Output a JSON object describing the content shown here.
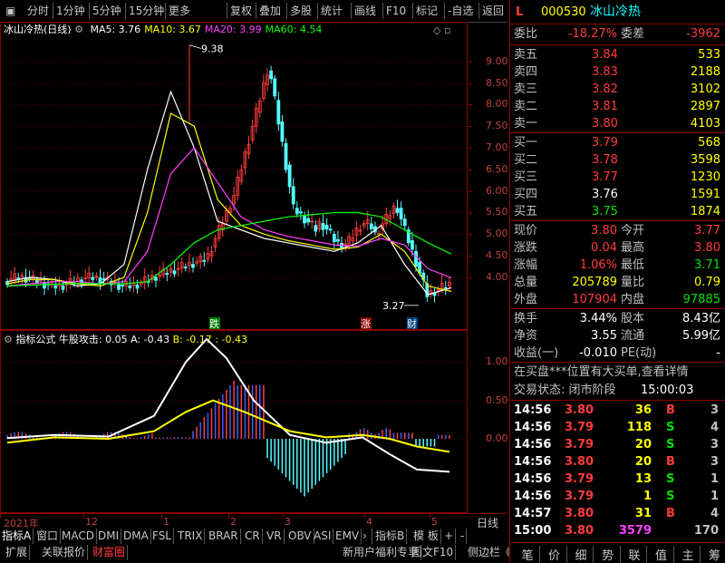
{
  "toolbar": {
    "items": [
      "分时",
      "1分钟",
      "5分钟",
      "15分钟",
      "更多",
      "复权",
      "叠加",
      "多股",
      "统计",
      "画线",
      "F10",
      "标记",
      "-自选",
      "返回"
    ]
  },
  "main_chart": {
    "title": "冰山冷热(日线)",
    "ma": [
      {
        "label": "MA5: 3.76",
        "color": "#ffffff"
      },
      {
        "label": "MA10: 3.67",
        "color": "#ffff00"
      },
      {
        "label": "MA20: 3.99",
        "color": "#ff40ff"
      },
      {
        "label": "MA60: 4.54",
        "color": "#00ff00"
      }
    ],
    "high_mark": "9.38",
    "low_mark": "3.27",
    "badges": [
      "跌",
      "涨",
      "财"
    ],
    "y_ticks": [
      "9.00",
      "8.50",
      "8.00",
      "7.50",
      "7.00",
      "6.50",
      "6.00",
      "5.50",
      "5.00",
      "4.50",
      "4.00"
    ]
  },
  "indicator": {
    "title": "指标公式",
    "name": "牛股攻击: 0.05",
    "a": "A: -0.43",
    "b": "B: -0.17",
    "c": ": -0.43",
    "y_ticks": [
      "1.00",
      "0.50",
      "0.00"
    ]
  },
  "x_axis": {
    "labels": [
      "2021年",
      "12",
      "1",
      "2",
      "3",
      "4",
      "5"
    ],
    "right": "日线"
  },
  "tabs1": [
    "指标A",
    "窗口",
    "MACD",
    "DMI",
    "DMA",
    "FSL",
    "TRIX",
    "BRAR",
    "CR",
    "VR",
    "OBV",
    "ASI",
    "EMV",
    "指标B",
    "模 板",
    "+",
    "-"
  ],
  "tabs2": [
    "扩展",
    "关联报价",
    "财富圈",
    "新用户福利专享",
    "图文F10",
    "侧边栏《"
  ],
  "chart_data": {
    "type": "line",
    "title": "冰山冷热(日线)",
    "x": [
      "2021年",
      "12",
      "1",
      "2",
      "3",
      "4",
      "5"
    ],
    "ylim": [
      3.2,
      9.5
    ],
    "series": [
      {
        "name": "MA5",
        "values": [
          3.9,
          4.0,
          3.95,
          3.8,
          3.85,
          4.3,
          6.5,
          8.3,
          7.0,
          5.3,
          5.1,
          4.9,
          4.8,
          4.7,
          4.6,
          4.8,
          5.2,
          4.3,
          3.6,
          3.76
        ]
      },
      {
        "name": "MA10",
        "values": [
          3.85,
          3.95,
          3.95,
          3.85,
          3.8,
          4.0,
          5.5,
          7.8,
          7.5,
          5.8,
          5.2,
          5.0,
          4.85,
          4.75,
          4.65,
          4.7,
          5.0,
          4.6,
          3.8,
          3.67
        ]
      },
      {
        "name": "MA20",
        "values": [
          3.8,
          3.85,
          3.9,
          3.9,
          3.85,
          3.9,
          4.6,
          6.4,
          7.0,
          6.2,
          5.4,
          5.1,
          4.95,
          4.85,
          4.75,
          4.72,
          4.9,
          4.75,
          4.2,
          3.99
        ]
      },
      {
        "name": "MA60",
        "values": [
          3.8,
          3.82,
          3.84,
          3.86,
          3.85,
          3.85,
          3.9,
          4.3,
          4.8,
          5.1,
          5.2,
          5.3,
          5.4,
          5.45,
          5.5,
          5.5,
          5.4,
          5.1,
          4.8,
          4.54
        ]
      }
    ]
  },
  "stock": {
    "flag": "L",
    "code": "000530",
    "name": "冰山冷热"
  },
  "weibi": {
    "l1": "委比",
    "v1": "-18.27%",
    "l2": "委差",
    "v2": "-3962"
  },
  "sell": [
    {
      "label": "卖五",
      "price": "3.84",
      "vol": "533"
    },
    {
      "label": "卖四",
      "price": "3.83",
      "vol": "2188"
    },
    {
      "label": "卖三",
      "price": "3.82",
      "vol": "3102"
    },
    {
      "label": "卖二",
      "price": "3.81",
      "vol": "2897"
    },
    {
      "label": "卖一",
      "price": "3.80",
      "vol": "4103"
    }
  ],
  "buy": [
    {
      "label": "买一",
      "price": "3.79",
      "vol": "568",
      "pc": "red"
    },
    {
      "label": "买二",
      "price": "3.78",
      "vol": "3598",
      "pc": "red"
    },
    {
      "label": "买三",
      "price": "3.77",
      "vol": "1230",
      "pc": "red"
    },
    {
      "label": "买四",
      "price": "3.76",
      "vol": "1591",
      "pc": "white"
    },
    {
      "label": "买五",
      "price": "3.75",
      "vol": "1874",
      "pc": "green"
    }
  ],
  "quote": [
    {
      "l1": "现价",
      "v1": "3.80",
      "c1": "red",
      "l2": "今开",
      "v2": "3.77",
      "c2": "red"
    },
    {
      "l1": "涨跌",
      "v1": "0.04",
      "c1": "red",
      "l2": "最高",
      "v2": "3.80",
      "c2": "red"
    },
    {
      "l1": "涨幅",
      "v1": "1.06%",
      "c1": "red",
      "l2": "最低",
      "v2": "3.71",
      "c2": "green"
    },
    {
      "l1": "总量",
      "v1": "205789",
      "c1": "yellow",
      "l2": "量比",
      "v2": "0.79",
      "c2": "yellow"
    },
    {
      "l1": "外盘",
      "v1": "107904",
      "c1": "red",
      "l2": "内盘",
      "v2": "97885",
      "c2": "green"
    }
  ],
  "fund": [
    {
      "l1": "换手",
      "v1": "3.44%",
      "l2": "股本",
      "v2": "8.43亿"
    },
    {
      "l1": "净资",
      "v1": "3.55",
      "l2": "流通",
      "v2": "5.99亿"
    },
    {
      "l1": "收益(一)",
      "v1": "-0.010",
      "l2": "PE(动)",
      "v2": "-"
    }
  ],
  "notice": "在买盘***位置有大买单,查看详情",
  "trade_status": {
    "label": "交易状态: 闭市阶段",
    "time": "15:00:03"
  },
  "ticks": [
    {
      "t": "14:56",
      "p": "3.80",
      "pc": "red",
      "v": "36",
      "vc": "yellow",
      "s": "B",
      "sc": "red",
      "n": "3"
    },
    {
      "t": "14:56",
      "p": "3.79",
      "pc": "red",
      "v": "118",
      "vc": "yellow",
      "s": "S",
      "sc": "green",
      "n": "4"
    },
    {
      "t": "14:56",
      "p": "3.79",
      "pc": "red",
      "v": "20",
      "vc": "yellow",
      "s": "S",
      "sc": "green",
      "n": "3"
    },
    {
      "t": "14:56",
      "p": "3.80",
      "pc": "red",
      "v": "20",
      "vc": "yellow",
      "s": "B",
      "sc": "red",
      "n": "3"
    },
    {
      "t": "14:56",
      "p": "3.79",
      "pc": "red",
      "v": "13",
      "vc": "yellow",
      "s": "S",
      "sc": "green",
      "n": "1"
    },
    {
      "t": "14:56",
      "p": "3.79",
      "pc": "red",
      "v": "1",
      "vc": "yellow",
      "s": "S",
      "sc": "green",
      "n": "1"
    },
    {
      "t": "14:57",
      "p": "3.80",
      "pc": "red",
      "v": "31",
      "vc": "yellow",
      "s": "B",
      "sc": "red",
      "n": "4"
    },
    {
      "t": "15:00",
      "p": "3.80",
      "pc": "red",
      "v": "3579",
      "vc": "magenta",
      "s": "",
      "sc": "gray",
      "n": "170"
    }
  ],
  "bottom_tabs": [
    "笔",
    "价",
    "细",
    "势",
    "联",
    "值",
    "主",
    "筹"
  ]
}
